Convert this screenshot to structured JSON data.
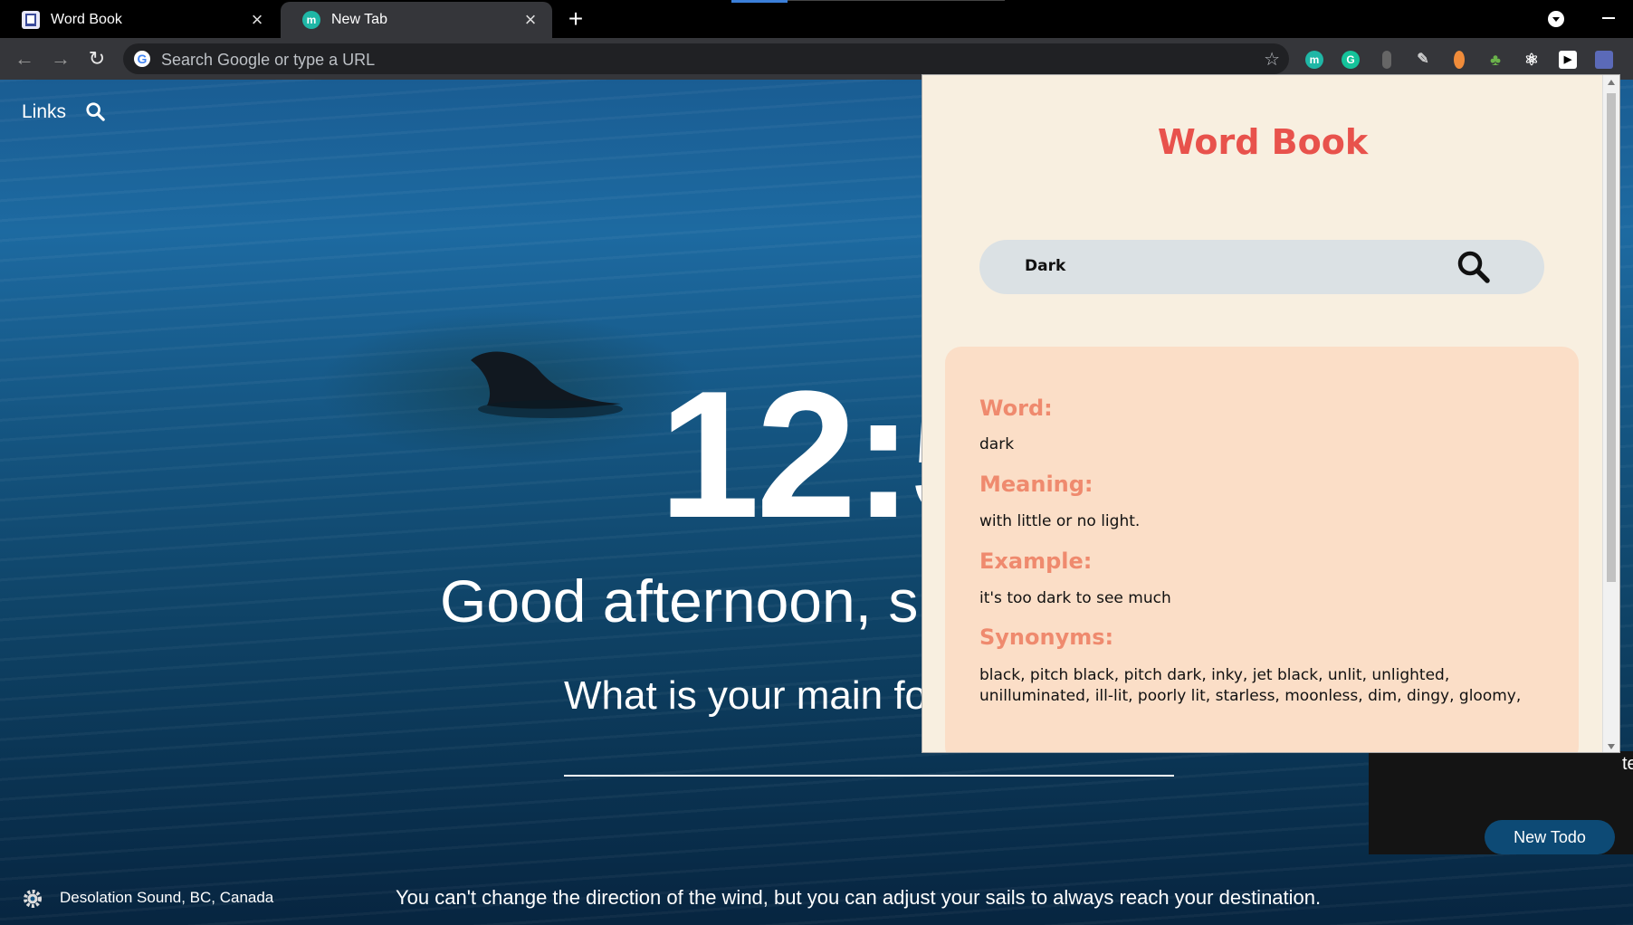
{
  "tabs": [
    {
      "title": "Word Book",
      "favicon": "book-icon"
    },
    {
      "title": "New Tab",
      "favicon": "momentum-icon"
    }
  ],
  "omnibox": {
    "placeholder": "Search Google or type a URL"
  },
  "extensions": [
    "momentum-icon",
    "grammarly-icon",
    "extension-icon",
    "pen-icon",
    "ball-icon",
    "tree-icon",
    "react-icon",
    "media-icon",
    "wordbook-icon"
  ],
  "newtab": {
    "links_label": "Links",
    "clock": "12:5",
    "greeting": "Good afternoon, s",
    "focus_question": "What is your main fo",
    "location": "Desolation Sound, BC, Canada",
    "quote": "You can't change the direction of the wind, but you can adjust your sails to always reach your destination.",
    "todo_button": "New Todo",
    "partial_text": "te"
  },
  "popup": {
    "title": "Word Book",
    "search_value": "Dark",
    "word_label": "Word:",
    "word": "dark",
    "meaning_label": "Meaning:",
    "meaning": "with little or no light.",
    "example_label": "Example:",
    "example": "it's too dark to see much",
    "synonyms_label": "Synonyms:",
    "synonyms": "black, pitch black, pitch dark, inky, jet black, unlit, unlighted, unilluminated, ill-lit, poorly lit, starless, moonless, dim, dingy, gloomy,"
  },
  "colors": {
    "title_red": "#e8524c",
    "label_salmon": "#ef8a6e",
    "popup_bg": "#f8efe0",
    "card_bg": "#fbdec7",
    "search_bg": "#dbe1e4"
  }
}
